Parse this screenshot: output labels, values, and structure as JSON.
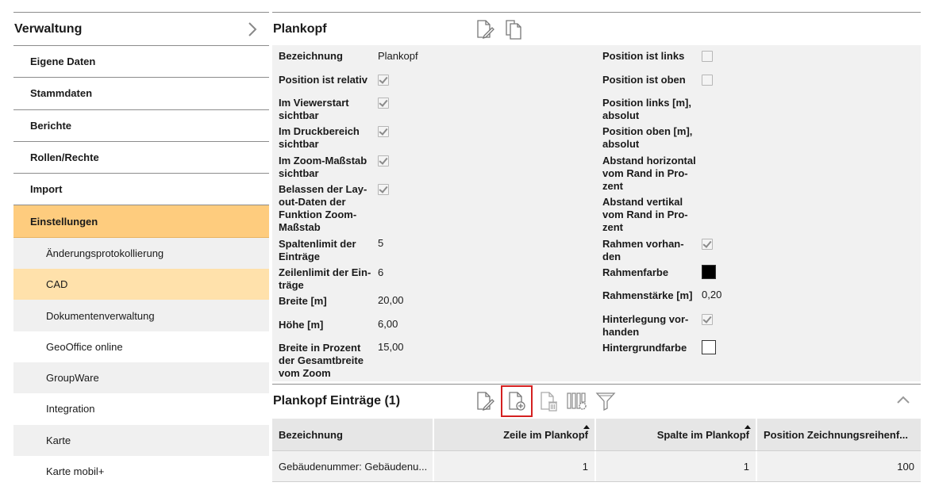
{
  "sidebar": {
    "title": "Verwaltung",
    "items": [
      {
        "label": "Eigene Daten"
      },
      {
        "label": "Stammdaten"
      },
      {
        "label": "Berichte"
      },
      {
        "label": "Rollen/Rechte"
      },
      {
        "label": "Import"
      },
      {
        "label": "Einstellungen"
      }
    ],
    "subitems": [
      {
        "label": "Änderungsprotokollierung"
      },
      {
        "label": "CAD"
      },
      {
        "label": "Dokumentenverwaltung"
      },
      {
        "label": "GeoOffice online"
      },
      {
        "label": "GroupWare"
      },
      {
        "label": "Integration"
      },
      {
        "label": "Karte"
      },
      {
        "label": "Karte mobil+"
      }
    ]
  },
  "plankopf": {
    "title": "Plankopf",
    "left": {
      "bezeichnung_label": "Bezeichnung",
      "bezeichnung_value": "Plankopf",
      "pos_relativ_label": "Position ist relativ",
      "viewerstart_label": "Im Viewerstart sichtbar",
      "druckbereich_label": "Im Druckbereich sichtbar",
      "zoom_label": "Im Zoom-Maßstab sichtbar",
      "belassen_label": "Belassen der Lay-out-Daten der Funktion Zoom-Maßstab",
      "spaltenlimit_label": "Spaltenlimit der Einträge",
      "spaltenlimit_value": "5",
      "zeilenlimit_label": "Zeilenlimit der Ein-träge",
      "zeilenlimit_value": "6",
      "breite_label": "Breite [m]",
      "breite_value": "20,00",
      "hoehe_label": "Höhe [m]",
      "hoehe_value": "6,00",
      "breite_prozent_label": "Breite in Prozent der Gesamtbreite vom Zoom",
      "breite_prozent_value": "15,00"
    },
    "right": {
      "pos_links_label": "Position ist links",
      "pos_oben_label": "Position ist oben",
      "pos_links_m_label": "Position links [m], absolut",
      "pos_oben_m_label": "Position oben [m], absolut",
      "abstand_h_label": "Abstand horizontal vom Rand in Pro-zent",
      "abstand_v_label": "Abstand vertikal vom Rand in Pro-zent",
      "rahmen_label": "Rahmen vorhan-den",
      "rahmenfarbe_label": "Rahmenfarbe",
      "rahmenfarbe_color": "#000000",
      "rahmenstaerke_label": "Rahmenstärke [m]",
      "rahmenstaerke_value": "0,20",
      "hinterlegung_label": "Hinterlegung vor-handen",
      "hintergrundfarbe_label": "Hintergrundfarbe",
      "hintergrundfarbe_color": "#ffffff"
    },
    "checks": {
      "pos_relativ": true,
      "viewerstart": true,
      "druckbereich": true,
      "zoom": true,
      "belassen": true,
      "pos_links": false,
      "pos_oben": false,
      "rahmen": true,
      "hinterlegung": true
    }
  },
  "eintraege": {
    "title": "Plankopf Einträge (1)",
    "columns": [
      "Bezeichnung",
      "Zeile im Plankopf",
      "Spalte im Plankopf",
      "Position Zeichnungsreihenf..."
    ],
    "rows": [
      [
        "Gebäudenummer: Gebäudenu...",
        "1",
        "1",
        "100"
      ]
    ]
  },
  "icons": [
    "chevron-right-icon",
    "edit-icon",
    "copy-icon",
    "new-document-icon",
    "delete-icon",
    "column-settings-icon",
    "filter-icon",
    "chevron-up-icon"
  ],
  "colors": {
    "active": "#fecc7e",
    "selected": "#ffe1ab",
    "highlight": "#d42020"
  }
}
